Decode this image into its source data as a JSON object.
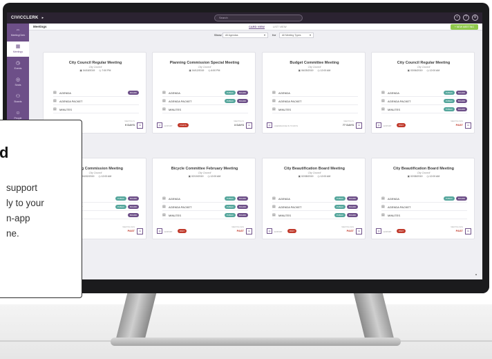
{
  "app": {
    "logo": "CIVICCLERK",
    "search_placeholder": "Search",
    "top_icons": [
      "add-circle-icon",
      "help-icon",
      "settings-icon"
    ]
  },
  "sidebar": {
    "items": [
      {
        "label": "MeetingClerk",
        "icon": "⇔",
        "active": false
      },
      {
        "label": "Meetings",
        "icon": "▦",
        "active": true
      },
      {
        "label": "Events",
        "icon": "◷",
        "active": false
      },
      {
        "label": "Seats",
        "icon": "◎",
        "active": false
      },
      {
        "label": "Boards",
        "icon": "⚇",
        "active": false
      },
      {
        "label": "People",
        "icon": "☺",
        "active": false
      },
      {
        "label": "",
        "icon": "⚙",
        "active": false
      }
    ]
  },
  "header": {
    "title": "Meetings",
    "tabs": [
      {
        "label": "CARD VIEW",
        "active": true
      },
      {
        "label": "LIST VIEW",
        "active": false
      }
    ],
    "new_button": "+ NEW MEETING"
  },
  "filters": {
    "show_label": "Show",
    "agenda_select": "All Agendas",
    "for_label": "for",
    "type_select": "All Meeting Types"
  },
  "cards": [
    {
      "title": "City Council Regular Meeting",
      "subtitle": "City Council",
      "date": "04/18/2019",
      "time": "7:00 PM",
      "docs": [
        {
          "label": "AGENDA",
          "badges": [
            "BOARD"
          ]
        },
        {
          "label": "AGENDA PACKET",
          "badges": []
        },
        {
          "label": "MINUTES",
          "badges": []
        }
      ],
      "footer": {
        "label": "",
        "past": false,
        "caption": "MEETING IN",
        "days": "9 DAYS"
      }
    },
    {
      "title": "Planning Commission Special Meeting",
      "subtitle": "City Council",
      "date": "04/12/2019",
      "time": "6:00 PM",
      "docs": [
        {
          "label": "AGENDA",
          "badges": [
            "PUBLIC",
            "BOARD"
          ]
        },
        {
          "label": "AGENDA PACKET",
          "badges": [
            "PUBLIC",
            "BOARD"
          ]
        },
        {
          "label": "MINUTES",
          "badges": []
        }
      ],
      "footer": {
        "label": "EXPORT",
        "past": true,
        "caption": "MEETING IN",
        "days": "3 DAYS"
      }
    },
    {
      "title": "Budget Committee Meeting",
      "subtitle": "City Council",
      "date": "06/25/2019",
      "time": "12:00 AM",
      "docs": [
        {
          "label": "AGENDA",
          "badges": []
        },
        {
          "label": "AGENDA PACKET",
          "badges": []
        },
        {
          "label": "MINUTES",
          "badges": []
        }
      ],
      "footer": {
        "label": "AGENDA DUE IN 73 DAYS",
        "past": false,
        "caption": "MEETING IN",
        "days": "77 DAYS"
      }
    },
    {
      "title": "City Council Regular Meeting",
      "subtitle": "City Council",
      "date": "03/06/2019",
      "time": "12:00 AM",
      "docs": [
        {
          "label": "AGENDA",
          "badges": [
            "PUBLIC",
            "BOARD"
          ]
        },
        {
          "label": "AGENDA PACKET",
          "badges": [
            "PUBLIC",
            "BOARD"
          ]
        },
        {
          "label": "MINUTES",
          "badges": [
            "PUBLIC",
            "BOARD"
          ]
        }
      ],
      "footer": {
        "label": "EXPORT",
        "past": true,
        "caption": "MEETING WAS",
        "days": "PAST"
      }
    },
    {
      "title": "Planning Commission Meeting",
      "subtitle": "City Council",
      "date": "04/02/2019",
      "time": "12:00 AM",
      "docs": [
        {
          "label": "AGENDA",
          "badges": [
            "PUBLIC",
            "BOARD"
          ]
        },
        {
          "label": "AGENDA PACKET",
          "badges": [
            "PUBLIC",
            "BOARD"
          ]
        },
        {
          "label": "MINUTES",
          "badges": [
            "BOARD"
          ]
        }
      ],
      "footer": {
        "label": "",
        "past": false,
        "caption": "MEETING WAS",
        "days": "PAST"
      }
    },
    {
      "title": "Bicycle Committee February Meeting",
      "subtitle": "City Council",
      "date": "02/19/2019",
      "time": "12:00 AM",
      "docs": [
        {
          "label": "AGENDA",
          "badges": [
            "PUBLIC",
            "BOARD"
          ]
        },
        {
          "label": "AGENDA PACKET",
          "badges": [
            "PUBLIC",
            "BOARD"
          ]
        },
        {
          "label": "MINUTES",
          "badges": [
            "PUBLIC",
            "BOARD"
          ]
        }
      ],
      "footer": {
        "label": "EXPORT",
        "past": true,
        "caption": "MEETING WAS",
        "days": "PAST"
      }
    },
    {
      "title": "City Beautification Board Meeting",
      "subtitle": "City Council",
      "date": "02/08/2019",
      "time": "12:00 AM",
      "docs": [
        {
          "label": "AGENDA",
          "badges": [
            "PUBLIC",
            "BOARD"
          ]
        },
        {
          "label": "AGENDA PACKET",
          "badges": [
            "PUBLIC",
            "BOARD"
          ]
        },
        {
          "label": "MINUTES",
          "badges": [
            "PUBLIC",
            "BOARD"
          ]
        }
      ],
      "footer": {
        "label": "EXPORT",
        "past": true,
        "caption": "MEETING WAS",
        "days": "PAST"
      }
    },
    {
      "title": "City Beautification Board Meeting",
      "subtitle": "City Council",
      "date": "02/08/2019",
      "time": "12:00 AM",
      "docs": [
        {
          "label": "AGENDA",
          "badges": [
            "PUBLIC",
            "BOARD"
          ]
        },
        {
          "label": "AGENDA PACKET",
          "badges": []
        },
        {
          "label": "MINUTES",
          "badges": []
        }
      ],
      "footer": {
        "label": "EXPORT",
        "past": true,
        "caption": "MEETING WAS",
        "days": "PAST"
      }
    }
  ],
  "popup": {
    "heading": "d",
    "lines": [
      "support",
      "ly to your",
      "n-app",
      "ne."
    ]
  },
  "colors": {
    "sidebar": "#6d4f88",
    "topbar": "#2b2331",
    "public_badge": "#55a69c",
    "board_badge": "#6d4f88",
    "past_badge": "#c0392b",
    "new_button": "#8fc84b"
  }
}
